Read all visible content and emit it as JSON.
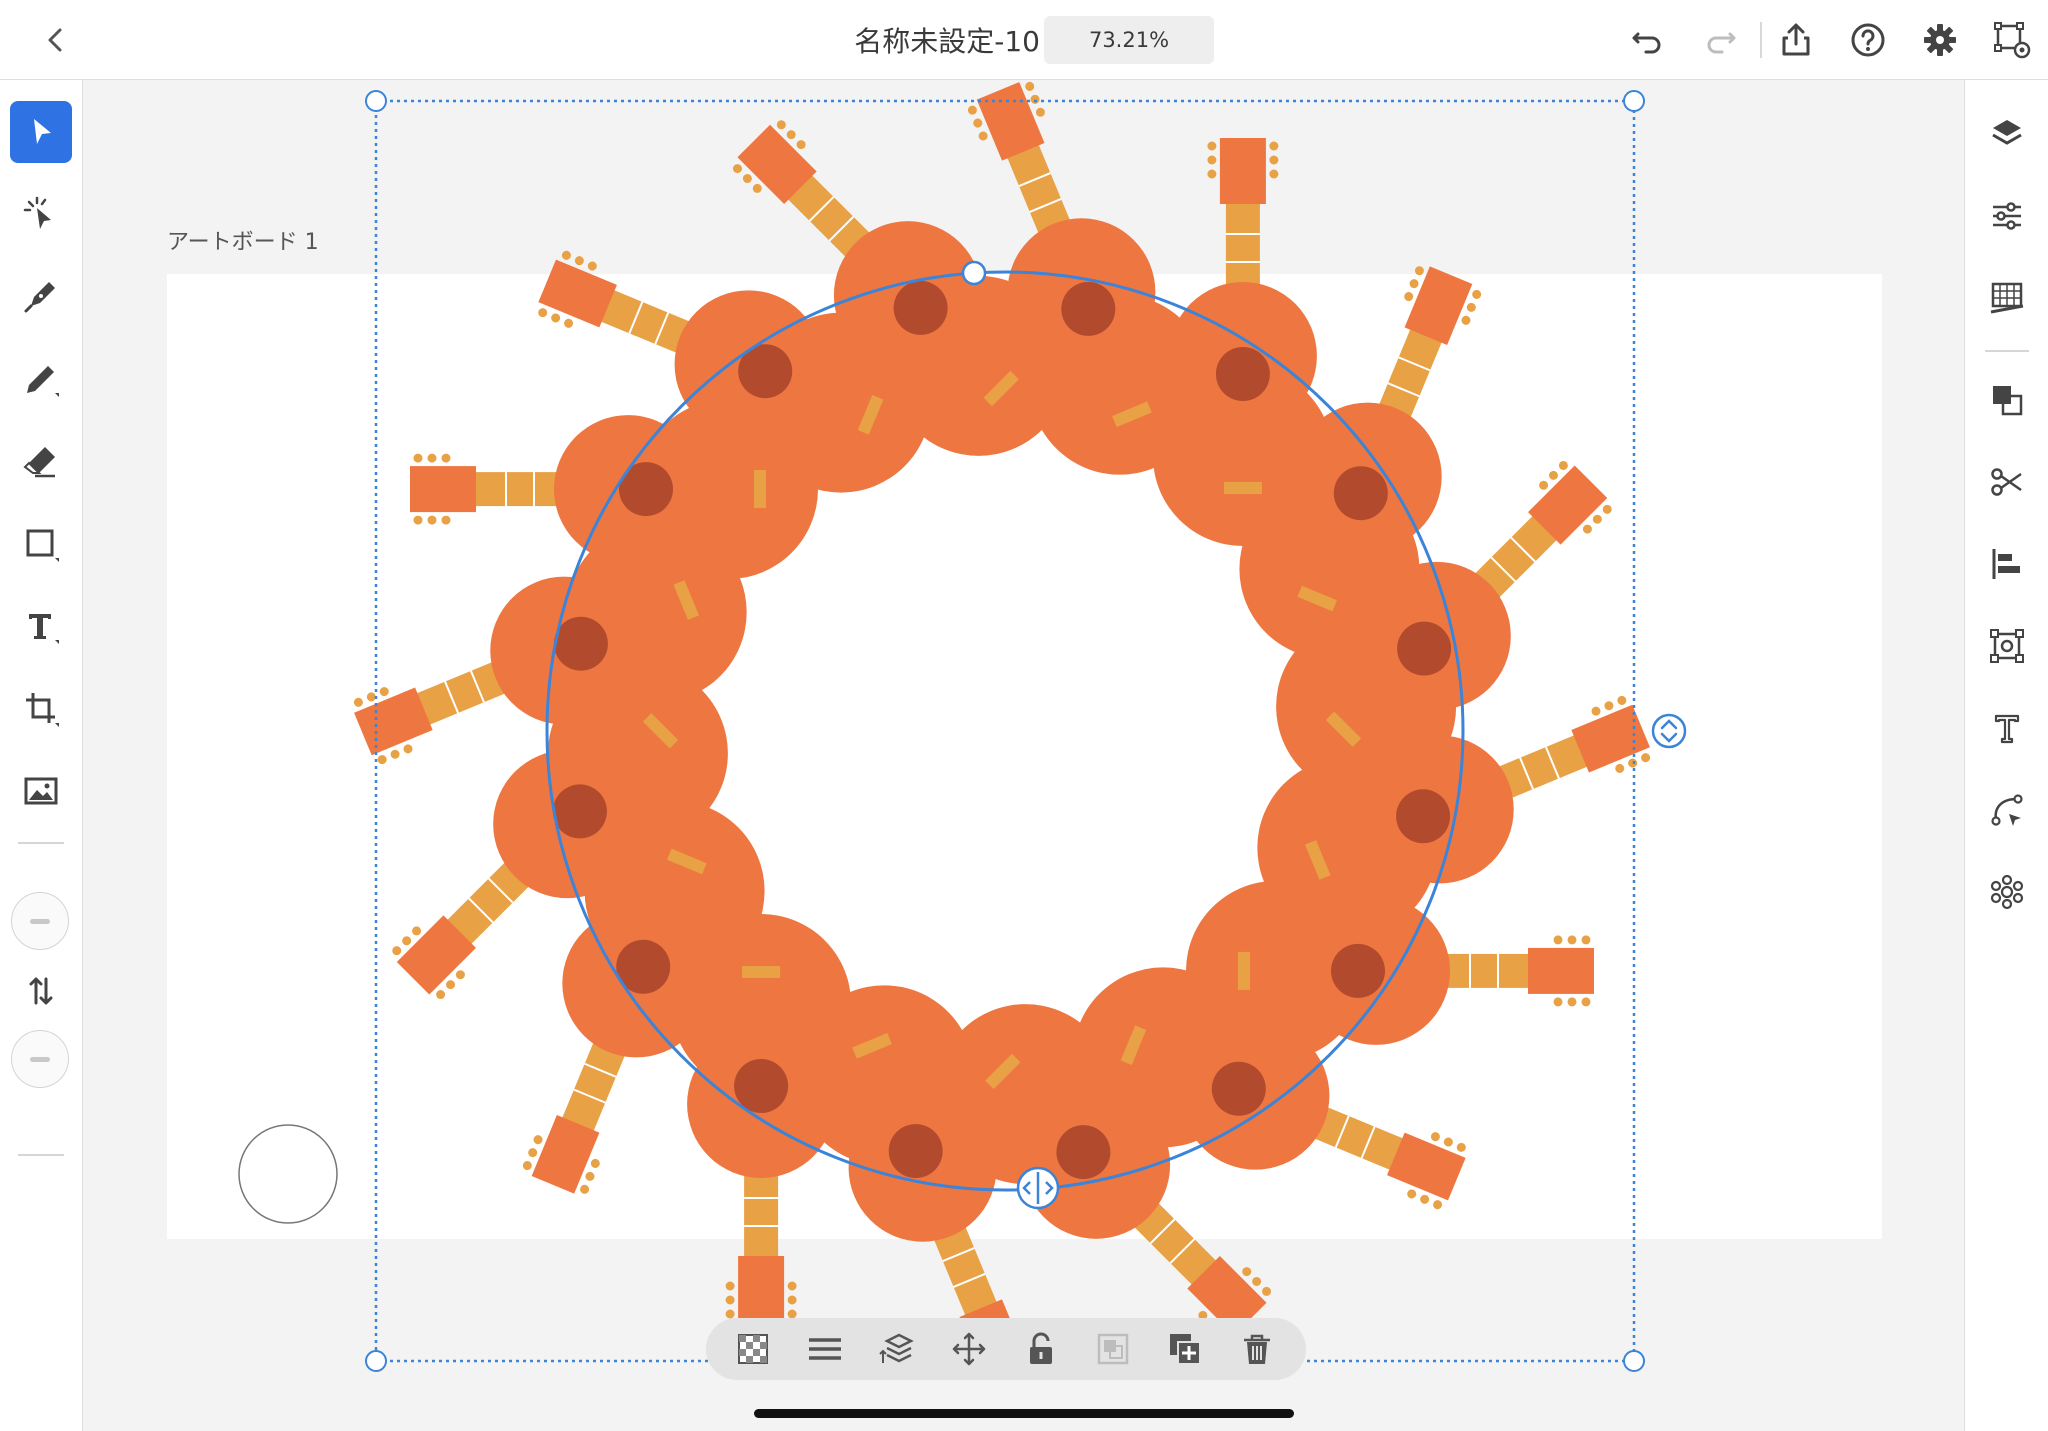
{
  "header": {
    "title": "名称未設定-10",
    "zoom": "73.21%",
    "back_icon": "chevron-left-icon",
    "undo_icon": "undo-icon",
    "redo_icon": "redo-icon",
    "share_icon": "share-icon",
    "help_icon": "help-icon",
    "settings_icon": "gear-icon",
    "preview_icon": "path-preview-icon"
  },
  "canvas": {
    "artboard_label": "アートボード 1",
    "artboard_color": "#ffffff",
    "guitar_count": 16,
    "guitar_colors": {
      "body": "#ee7640",
      "neck": "#e8a145",
      "head": "#ee7640",
      "hole": "#b24a2e"
    },
    "repeat_path_color": "#3b84d8",
    "selection_color": "#3b84d8"
  },
  "left_toolbar": {
    "tools": [
      {
        "name": "selection-tool",
        "icon": "arrow-icon",
        "active": true
      },
      {
        "name": "direct-selection-tool",
        "icon": "sparkle-pointer-icon",
        "active": false
      },
      {
        "name": "pen-tool",
        "icon": "pen-icon",
        "active": false
      },
      {
        "name": "pencil-tool",
        "icon": "pencil-icon",
        "active": false
      },
      {
        "name": "eraser-tool",
        "icon": "eraser-icon",
        "active": false
      },
      {
        "name": "shape-tool",
        "icon": "rectangle-icon",
        "active": false
      },
      {
        "name": "type-tool",
        "icon": "type-icon",
        "active": false
      },
      {
        "name": "transform-tool",
        "icon": "crop-icon",
        "active": false
      },
      {
        "name": "place-image-tool",
        "icon": "image-icon",
        "active": false
      }
    ],
    "swap_icon": "swap-arrows-icon"
  },
  "right_toolbar": {
    "items": [
      "layers-icon",
      "properties-icon",
      "grid-icon",
      "combine-shapes-icon",
      "scissors-icon",
      "align-icon",
      "transform-icon",
      "glyphs-icon",
      "path-icon",
      "repeat-icon"
    ]
  },
  "action_bar": {
    "items": [
      "opacity-icon",
      "blend-icon",
      "arrange-icon",
      "move-icon",
      "unlock-icon",
      "group-icon",
      "duplicate-icon",
      "delete-icon"
    ]
  }
}
